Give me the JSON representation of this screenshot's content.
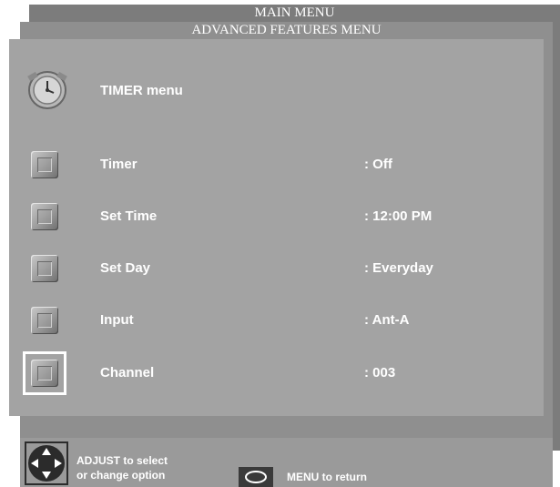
{
  "menus": {
    "main_title": "MAIN MENU",
    "advanced_title": "ADVANCED FEATURES MENU"
  },
  "timer_menu": {
    "title": "TIMER menu",
    "icon": "clock-icon",
    "items": [
      {
        "label": "Timer",
        "value": ":  Off"
      },
      {
        "label": "Set Time",
        "value": ": 12:00 PM"
      },
      {
        "label": "Set Day",
        "value": ": Everyday"
      },
      {
        "label": "Input",
        "value": ": Ant-A"
      },
      {
        "label": "Channel",
        "value": ": 003"
      }
    ],
    "selected_index": 4
  },
  "footer": {
    "adjust_line1": "ADJUST to select",
    "adjust_line2": "or  change  option",
    "menu_text": "MENU  to  return",
    "dpad_icon": "dpad-icon",
    "menu_icon": "menu-button-icon"
  },
  "colors": {
    "panel": "#a3a3a3",
    "text": "#ffffff",
    "selection": "#ffffff"
  }
}
